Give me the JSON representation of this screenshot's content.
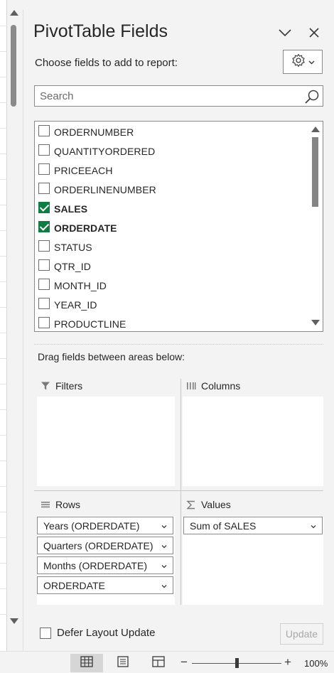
{
  "panel": {
    "title": "PivotTable Fields",
    "instruction": "Choose fields to add to report:",
    "search_placeholder": "Search"
  },
  "fields": [
    {
      "label": "ORDERNUMBER",
      "checked": false
    },
    {
      "label": "QUANTITYORDERED",
      "checked": false
    },
    {
      "label": "PRICEEACH",
      "checked": false
    },
    {
      "label": "ORDERLINENUMBER",
      "checked": false
    },
    {
      "label": "SALES",
      "checked": true
    },
    {
      "label": "ORDERDATE",
      "checked": true
    },
    {
      "label": "STATUS",
      "checked": false
    },
    {
      "label": "QTR_ID",
      "checked": false
    },
    {
      "label": "MONTH_ID",
      "checked": false
    },
    {
      "label": "YEAR_ID",
      "checked": false
    },
    {
      "label": "PRODUCTLINE",
      "checked": false
    }
  ],
  "areas": {
    "drag_label": "Drag fields between areas below:",
    "filters_label": "Filters",
    "columns_label": "Columns",
    "rows_label": "Rows",
    "values_label": "Values",
    "rows_items": [
      "Years (ORDERDATE)",
      "Quarters (ORDERDATE)",
      "Months (ORDERDATE)",
      "ORDERDATE"
    ],
    "values_items": [
      "Sum of SALES"
    ]
  },
  "footer": {
    "defer_label": "Defer Layout Update",
    "update_label": "Update"
  },
  "status": {
    "zoom_minus": "−",
    "zoom_plus": "+",
    "zoom_level": "100%"
  },
  "colors": {
    "checkbox_checked": "#107c41"
  }
}
